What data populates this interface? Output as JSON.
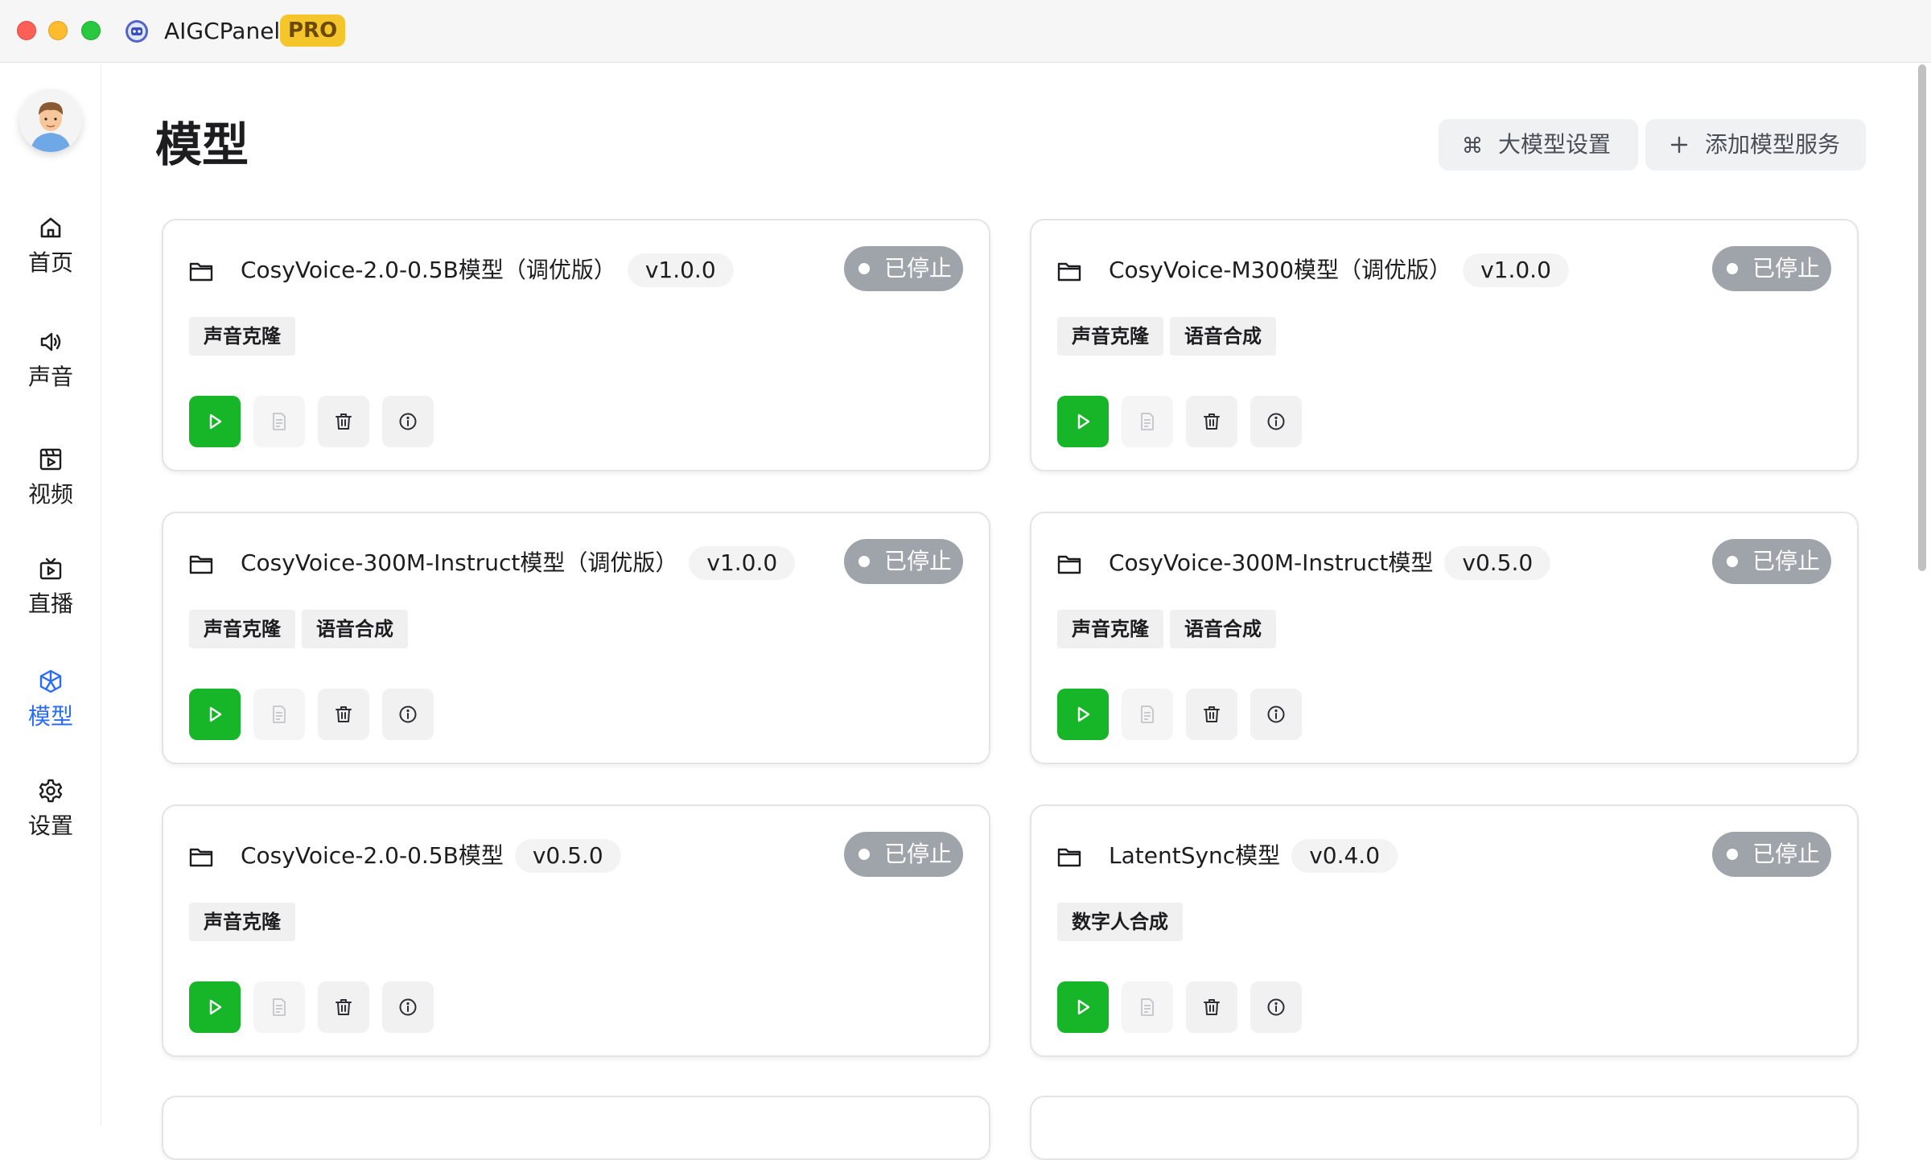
{
  "window": {
    "app_title": "AIGCPanel",
    "badge": "PRO"
  },
  "sidebar": {
    "items": [
      {
        "label": "首页",
        "icon": "home-icon",
        "active": false
      },
      {
        "label": "声音",
        "icon": "speaker-icon",
        "active": false
      },
      {
        "label": "视频",
        "icon": "video-icon",
        "active": false
      },
      {
        "label": "直播",
        "icon": "live-tv-icon",
        "active": false
      },
      {
        "label": "模型",
        "icon": "model-cube-icon",
        "active": true
      },
      {
        "label": "设置",
        "icon": "gear-icon",
        "active": false
      }
    ]
  },
  "header": {
    "title": "模型",
    "llm_settings_label": "大模型设置",
    "add_service_label": "添加模型服务"
  },
  "cards": [
    {
      "name": "CosyVoice-2.0-0.5B模型（调优版）",
      "version": "v1.0.0",
      "status": "已停止",
      "tags": [
        "声音克隆"
      ]
    },
    {
      "name": "CosyVoice-M300模型（调优版）",
      "version": "v1.0.0",
      "status": "已停止",
      "tags": [
        "声音克隆",
        "语音合成"
      ]
    },
    {
      "name": "CosyVoice-300M-Instruct模型（调优版）",
      "version": "v1.0.0",
      "status": "已停止",
      "tags": [
        "声音克隆",
        "语音合成"
      ]
    },
    {
      "name": "CosyVoice-300M-Instruct模型",
      "version": "v0.5.0",
      "status": "已停止",
      "tags": [
        "声音克隆",
        "语音合成"
      ]
    },
    {
      "name": "CosyVoice-2.0-0.5B模型",
      "version": "v0.5.0",
      "status": "已停止",
      "tags": [
        "声音克隆"
      ]
    },
    {
      "name": "LatentSync模型",
      "version": "v0.4.0",
      "status": "已停止",
      "tags": [
        "数字人合成"
      ]
    }
  ],
  "colors": {
    "accent": "#2b6cf6",
    "run_button": "#17b528",
    "status_stopped": "#9fa3aa",
    "pro_badge": "#f5c62c"
  }
}
